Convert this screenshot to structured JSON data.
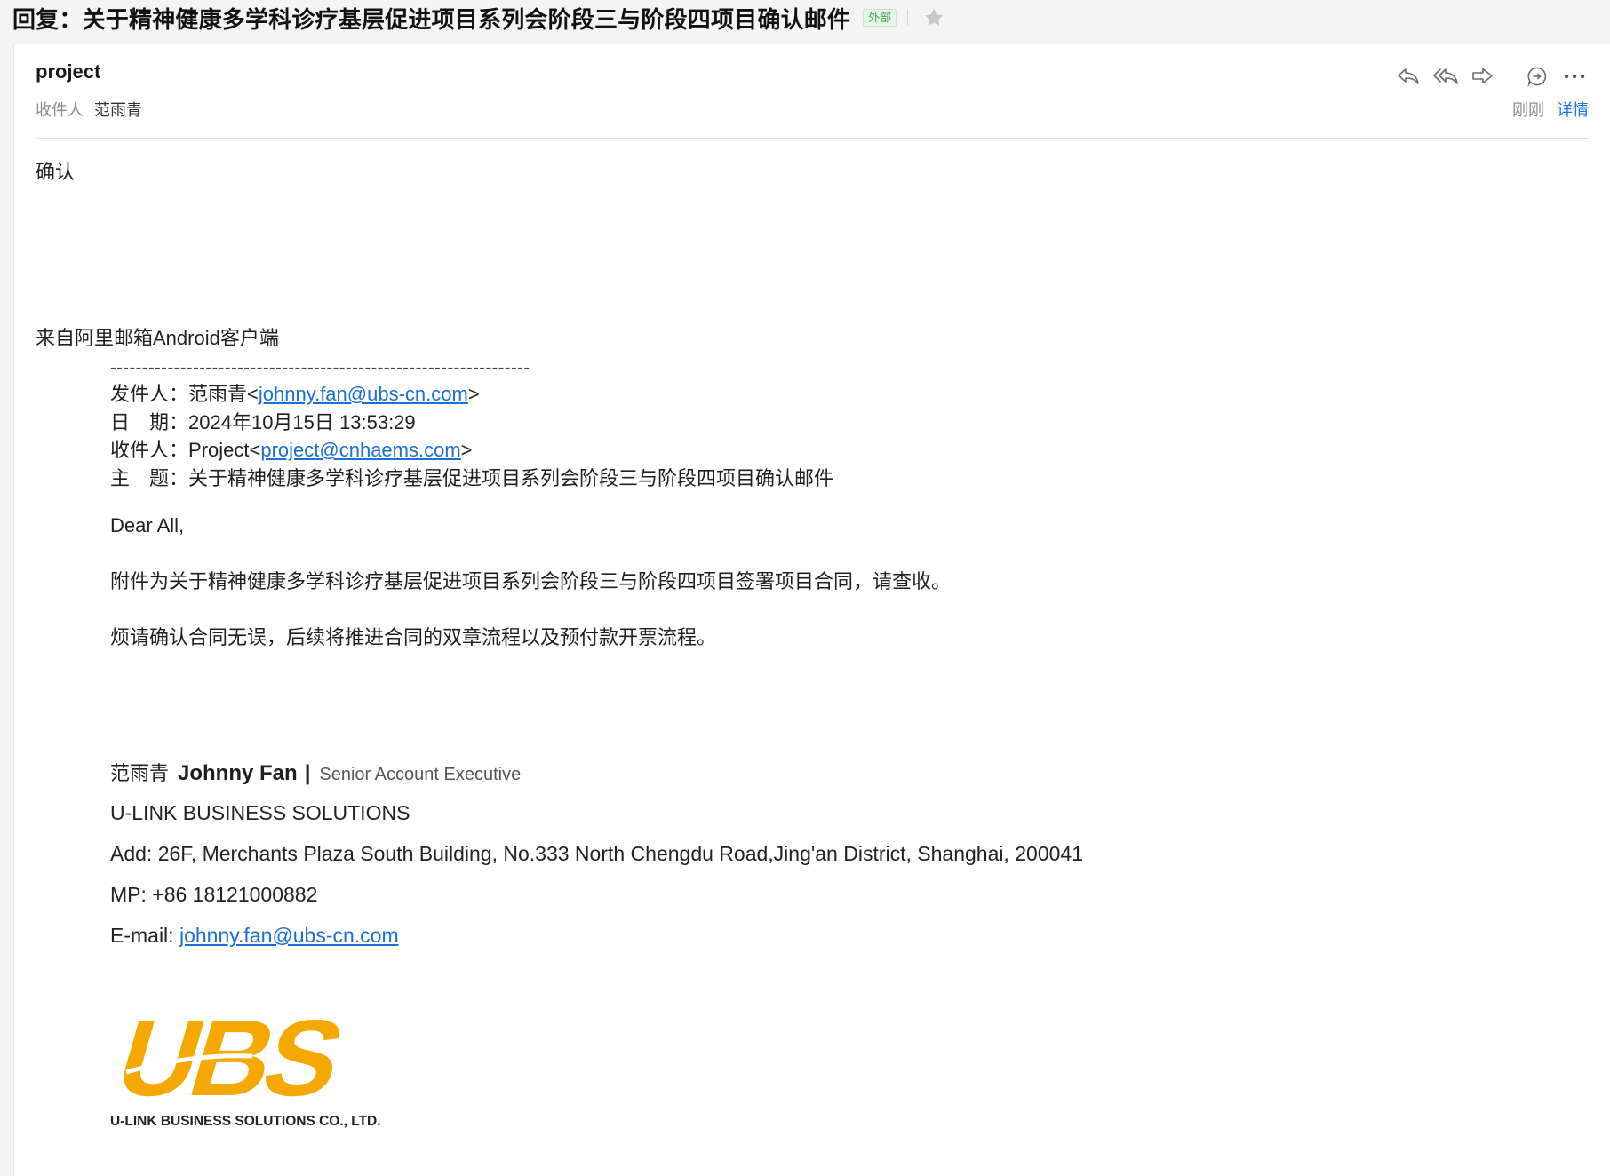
{
  "title_bar": {
    "subject": "回复：关于精神健康多学科诊疗基层促进项目系列会阶段三与阶段四项目确认邮件",
    "badge": "外部"
  },
  "header": {
    "sender": "project",
    "recipient_label": "收件人",
    "recipient": "范雨青",
    "time": "刚刚",
    "detail_link": "详情"
  },
  "body": {
    "reply_text": "确认",
    "signature_client": "来自阿里邮箱Android客户端",
    "quote": {
      "divider": "------------------------------------------------------------------",
      "from_label": "发件人：",
      "from_name": "范雨青",
      "from_email": "johnny.fan@ubs-cn.com",
      "date_label": "日　期：",
      "date_value": "2024年10月15日 13:53:29",
      "to_label": "收件人：",
      "to_name": "Project",
      "to_email": "project@cnhaems.com",
      "subject_label": "主　题：",
      "subject_value": "关于精神健康多学科诊疗基层促进项目系列会阶段三与阶段四项目确认邮件",
      "greeting": "Dear All,",
      "para1": "附件为关于精神健康多学科诊疗基层促进项目系列会阶段三与阶段四项目签署项目合同，请查收。",
      "para2": "烦请确认合同无误，后续将推进合同的双章流程以及预付款开票流程。"
    },
    "signature": {
      "cn_name": "范雨青",
      "en_name": "Johnny Fan",
      "separator": "|",
      "role": "Senior Account Executive",
      "company": "U-LINK BUSINESS SOLUTIONS",
      "address": "Add: 26F, Merchants Plaza South Building, No.333 North Chengdu Road,Jing'an District, Shanghai, 200041",
      "phone": "MP: +86 18121000882",
      "email_label": "E-mail: ",
      "email": "johnny.fan@ubs-cn.com"
    },
    "logo": {
      "mark": "UBS",
      "caption": "U-LINK BUSINESS SOLUTIONS CO., LTD.",
      "color": "#f5a800"
    }
  },
  "colors": {
    "link": "#1a6fd6",
    "accent": "#1a73e8",
    "badge_green": "#3aa24a"
  }
}
